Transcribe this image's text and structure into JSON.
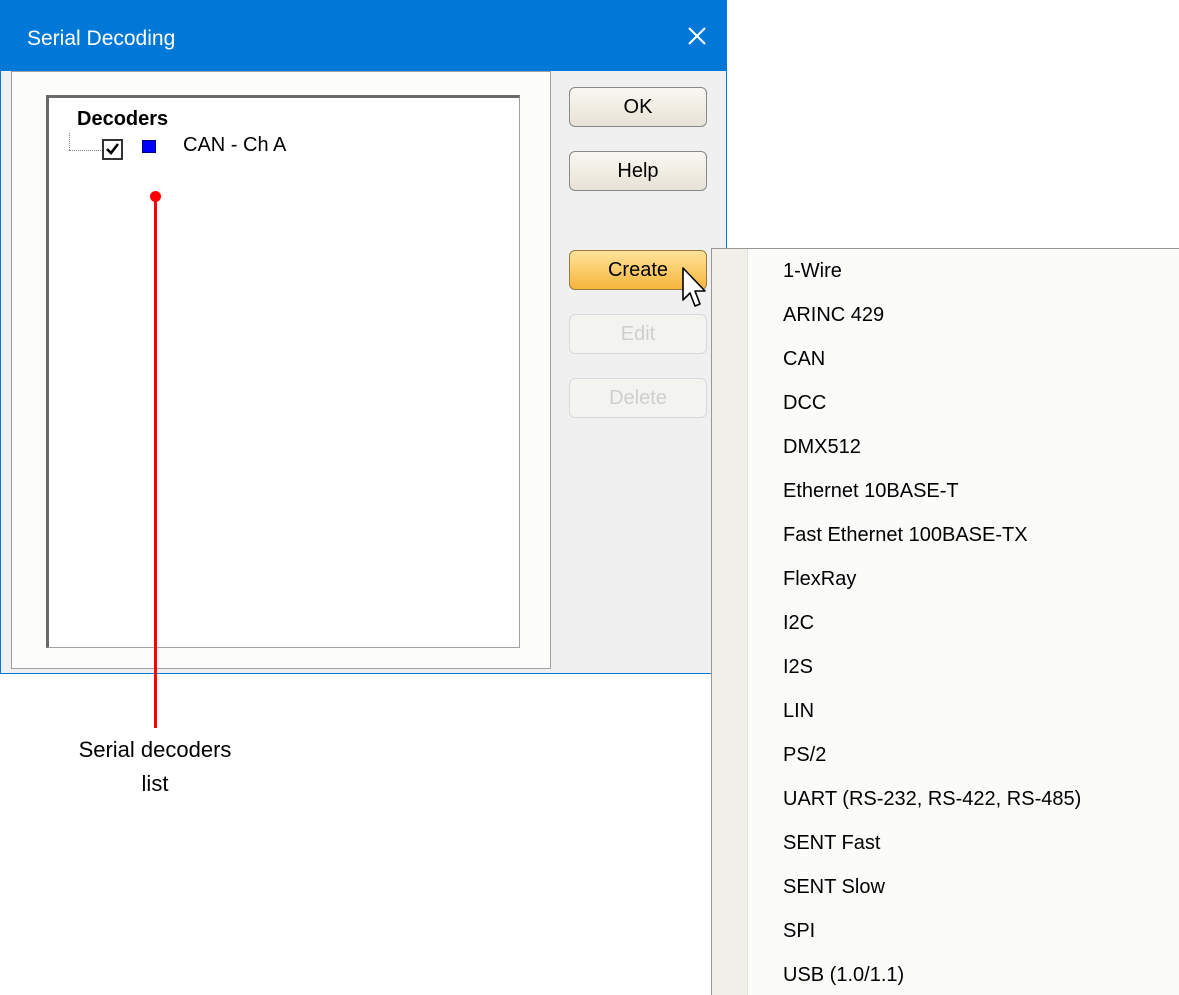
{
  "dialog": {
    "title": "Serial Decoding",
    "close_icon": "close-icon"
  },
  "decoders": {
    "root_label": "Decoders",
    "items": [
      {
        "label": "CAN - Ch A",
        "checked": true,
        "color": "#0000ff"
      }
    ]
  },
  "buttons": {
    "ok": "OK",
    "help": "Help",
    "create": "Create",
    "edit": "Edit",
    "delete": "Delete"
  },
  "annotation": {
    "line1": "Serial decoders",
    "line2": "list",
    "color": "#ff0000"
  },
  "create_menu": {
    "items": [
      "1-Wire",
      "ARINC 429",
      "CAN",
      "DCC",
      "DMX512",
      "Ethernet 10BASE-T",
      "Fast Ethernet 100BASE-TX",
      "FlexRay",
      "I2C",
      "I2S",
      "LIN",
      "PS/2",
      "UART (RS-232, RS-422, RS-485)",
      "SENT Fast",
      "SENT Slow",
      "SPI",
      "USB (1.0/1.1)"
    ]
  },
  "colors": {
    "titlebar": "#0078d7",
    "create_button": "#f6b53a"
  }
}
